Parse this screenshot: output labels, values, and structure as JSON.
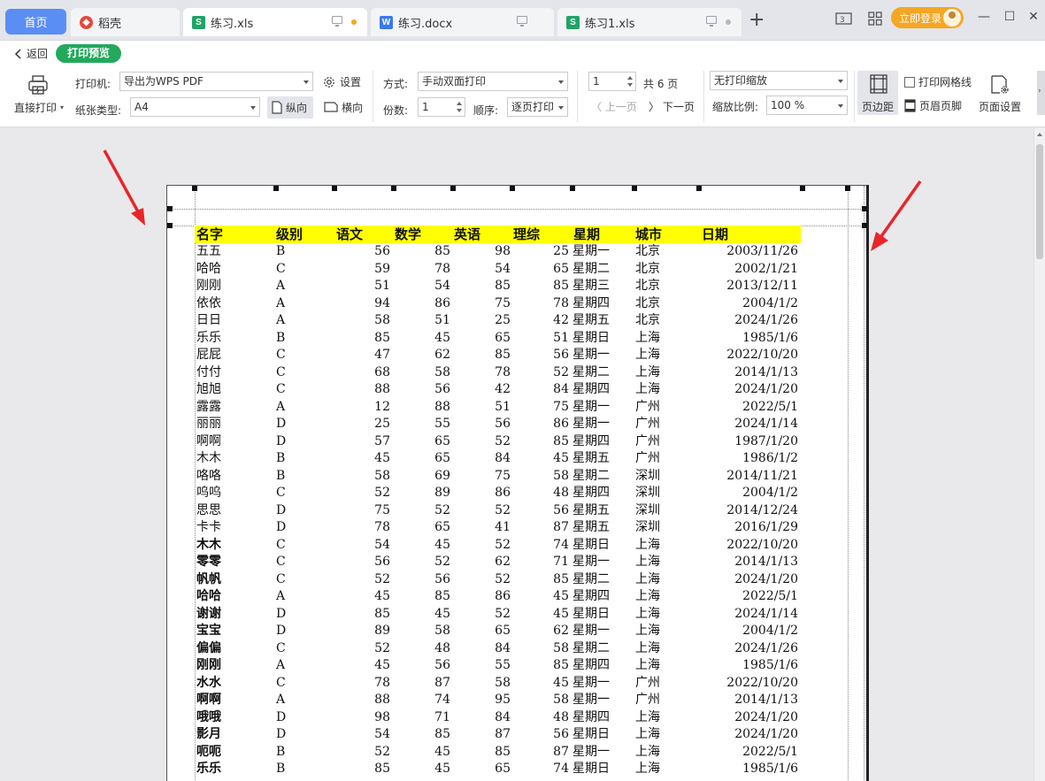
{
  "tabs": [
    {
      "label": "首页",
      "icon": ""
    },
    {
      "label": "稻壳",
      "icon": "docer-icon"
    },
    {
      "label": "练习.xls",
      "icon": "spreadsheet-icon",
      "modified_dot_color": "#f5a623"
    },
    {
      "label": "练习.docx",
      "icon": "document-icon"
    },
    {
      "label": "练习1.xls",
      "icon": "spreadsheet-icon"
    }
  ],
  "titlebar": {
    "login_label": "立即登录",
    "badge": "3",
    "new_tab": "+",
    "minimize": "—",
    "maximize": "☐",
    "close": "✕"
  },
  "toolbar": {
    "back_label": "返回",
    "mode_badge": "打印预览",
    "direct_print_label": "直接打印",
    "printer_label": "打印机:",
    "printer_value": "导出为WPS PDF",
    "settings_label": "设置",
    "paper_label": "纸张类型:",
    "paper_value": "A4",
    "portrait_label": "纵向",
    "landscape_label": "横向",
    "mode_label": "方式:",
    "mode_value": "手动双面打印",
    "copies_label": "份数:",
    "copies_value": "1",
    "order_label": "顺序:",
    "order_value": "逐页打印",
    "page_value": "1",
    "total_pages": "共 6 页",
    "prev_page": "上一页",
    "next_page": "下一页",
    "scaling_value": "无打印缩放",
    "zoom_label": "缩放比例:",
    "zoom_value": "100 %",
    "margins_label": "页边距",
    "gridlines_label": "打印网格线",
    "header_footer_label": "页眉页脚",
    "page_setup_label": "页面设置"
  },
  "colors": {
    "home_tab": "#5a8ef5",
    "badge_green": "#23a85c",
    "login_orange": "#f5a623",
    "header_fill": "#ffff00",
    "arrow_red": "#e8262a"
  },
  "sheet": {
    "headers": [
      "名字",
      "级别",
      "语文",
      "数学",
      "英语",
      "理综",
      "星期",
      "城市",
      "日期"
    ],
    "rows": [
      [
        "五五",
        "B",
        "56",
        "85",
        "98",
        "25",
        "星期一",
        "北京",
        "2003/11/26"
      ],
      [
        "哈哈",
        "C",
        "59",
        "78",
        "54",
        "65",
        "星期二",
        "北京",
        "2002/1/21"
      ],
      [
        "刚刚",
        "A",
        "51",
        "54",
        "85",
        "85",
        "星期三",
        "北京",
        "2013/12/11"
      ],
      [
        "依依",
        "A",
        "94",
        "86",
        "75",
        "78",
        "星期四",
        "北京",
        "2004/1/2"
      ],
      [
        "日日",
        "A",
        "58",
        "51",
        "25",
        "42",
        "星期五",
        "北京",
        "2024/1/26"
      ],
      [
        "乐乐",
        "B",
        "85",
        "45",
        "65",
        "51",
        "星期日",
        "上海",
        "1985/1/6"
      ],
      [
        "屁屁",
        "C",
        "47",
        "62",
        "85",
        "56",
        "星期一",
        "上海",
        "2022/10/20"
      ],
      [
        "付付",
        "C",
        "68",
        "58",
        "78",
        "52",
        "星期二",
        "上海",
        "2014/1/13"
      ],
      [
        "旭旭",
        "C",
        "88",
        "56",
        "42",
        "84",
        "星期四",
        "上海",
        "2024/1/20"
      ],
      [
        "露露",
        "A",
        "12",
        "88",
        "51",
        "75",
        "星期一",
        "广州",
        "2022/5/1"
      ],
      [
        "丽丽",
        "D",
        "25",
        "55",
        "56",
        "86",
        "星期一",
        "广州",
        "2024/1/14"
      ],
      [
        "啊啊",
        "D",
        "57",
        "65",
        "52",
        "85",
        "星期四",
        "广州",
        "1987/1/20"
      ],
      [
        "木木",
        "B",
        "45",
        "65",
        "84",
        "45",
        "星期五",
        "广州",
        "1986/1/2"
      ],
      [
        "咯咯",
        "B",
        "58",
        "69",
        "75",
        "58",
        "星期二",
        "深圳",
        "2014/11/21"
      ],
      [
        "呜呜",
        "C",
        "52",
        "89",
        "86",
        "48",
        "星期四",
        "深圳",
        "2004/1/2"
      ],
      [
        "思思",
        "D",
        "75",
        "52",
        "52",
        "56",
        "星期五",
        "深圳",
        "2014/12/24"
      ],
      [
        "卡卡",
        "D",
        "78",
        "65",
        "41",
        "87",
        "星期五",
        "深圳",
        "2016/1/29"
      ],
      [
        "木木",
        "C",
        "54",
        "45",
        "52",
        "74",
        "星期日",
        "上海",
        "2022/10/20"
      ],
      [
        "零零",
        "C",
        "56",
        "52",
        "62",
        "71",
        "星期一",
        "上海",
        "2014/1/13"
      ],
      [
        "帆帆",
        "C",
        "52",
        "56",
        "52",
        "85",
        "星期二",
        "上海",
        "2024/1/20"
      ],
      [
        "哈哈",
        "A",
        "45",
        "85",
        "86",
        "45",
        "星期四",
        "上海",
        "2022/5/1"
      ],
      [
        "谢谢",
        "D",
        "85",
        "45",
        "52",
        "45",
        "星期日",
        "上海",
        "2024/1/14"
      ],
      [
        "宝宝",
        "D",
        "89",
        "58",
        "65",
        "62",
        "星期一",
        "上海",
        "2004/1/2"
      ],
      [
        "偏偏",
        "C",
        "52",
        "48",
        "84",
        "58",
        "星期二",
        "上海",
        "2024/1/26"
      ],
      [
        "刚刚",
        "A",
        "45",
        "56",
        "55",
        "85",
        "星期四",
        "上海",
        "1985/1/6"
      ],
      [
        "水水",
        "C",
        "78",
        "87",
        "58",
        "45",
        "星期一",
        "广州",
        "2022/10/20"
      ],
      [
        "啊啊",
        "A",
        "88",
        "74",
        "95",
        "58",
        "星期一",
        "广州",
        "2014/1/13"
      ],
      [
        "哦哦",
        "D",
        "98",
        "71",
        "84",
        "48",
        "星期四",
        "上海",
        "2024/1/20"
      ],
      [
        "影月",
        "D",
        "54",
        "85",
        "87",
        "56",
        "星期日",
        "上海",
        "2024/1/20"
      ],
      [
        "呃呃",
        "B",
        "52",
        "45",
        "85",
        "87",
        "星期一",
        "上海",
        "2022/5/1"
      ],
      [
        "乐乐",
        "B",
        "85",
        "45",
        "65",
        "74",
        "星期日",
        "上海",
        "1985/1/6"
      ]
    ],
    "bold_name_rows_from": 17
  }
}
